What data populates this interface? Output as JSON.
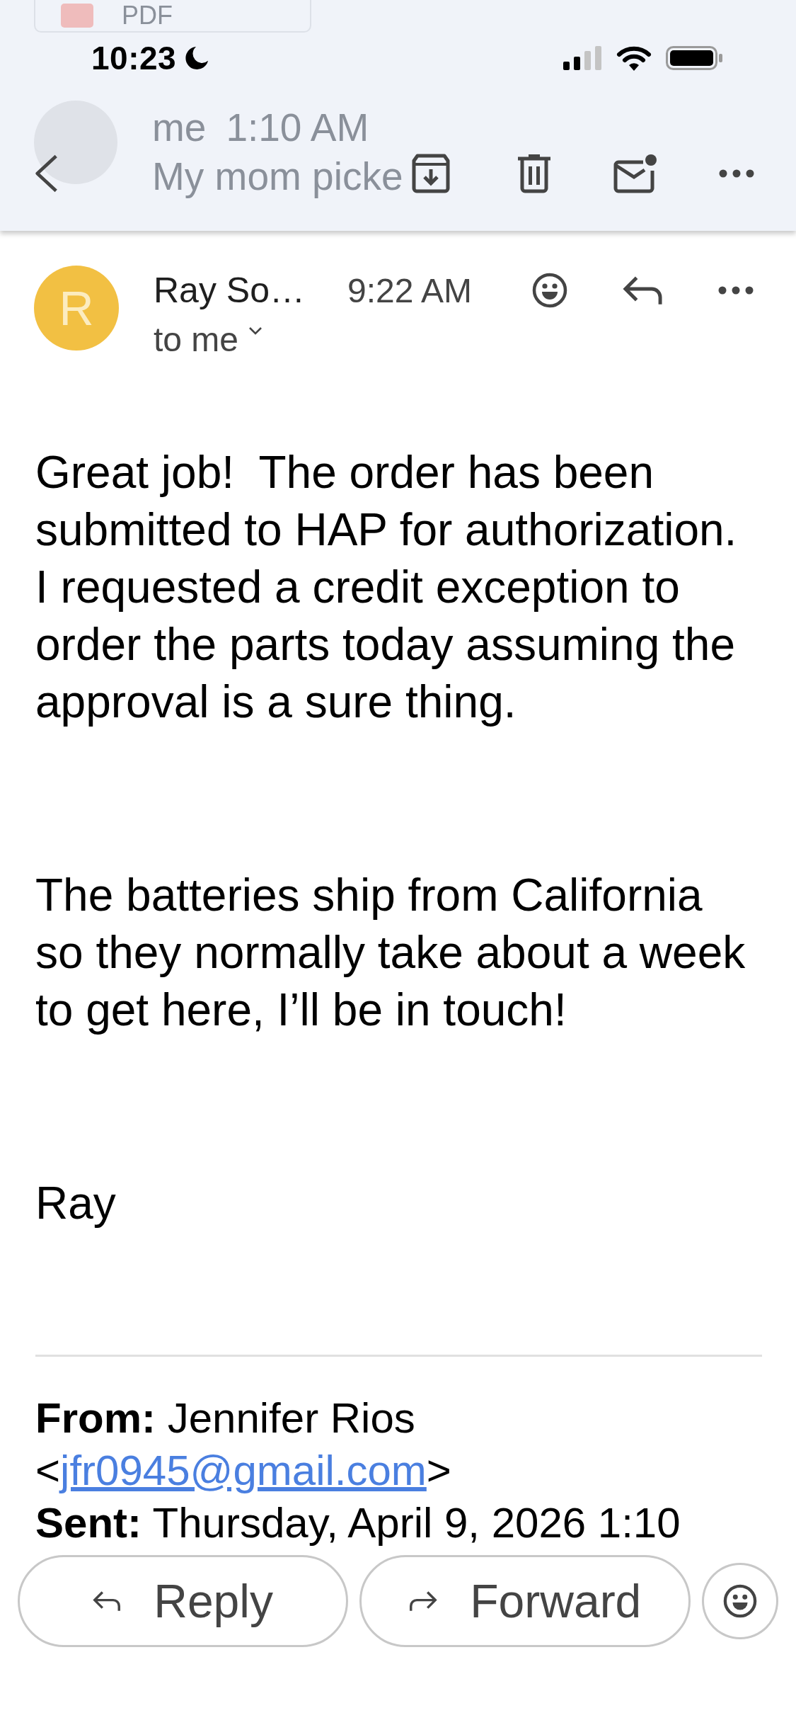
{
  "status_bar": {
    "time": "10:23",
    "focus_on": true
  },
  "behind_header": {
    "attachment": {
      "label": "PDF"
    },
    "previous_message": {
      "sender": "me",
      "time": "1:10 AM",
      "snippet": "My mom picke"
    }
  },
  "message": {
    "sender": {
      "initial": "R",
      "name": "Ray So…"
    },
    "time": "9:22 AM",
    "recipients": "to me",
    "details_expanded": false,
    "paragraphs": [
      "Great job!  The order has been submitted to HAP for authorization. I requested a credit exception to order the parts today assuming the approval is a sure thing.",
      "The batteries ship from California so they normally take about a week to get here, I’ll be in touch!",
      "Ray"
    ],
    "quoted_header": [
      {
        "label": "From:",
        "value": "Jennifer Rios",
        "link_before": "<",
        "link": "jfr0945@gmail.com",
        "link_after": ">"
      },
      {
        "label": "Sent:",
        "value": "Thursday, April 9, 2026 1:10"
      }
    ]
  },
  "bottom_actions": [
    {
      "kind": "reply",
      "label": "Reply"
    },
    {
      "kind": "forward",
      "label": "Forward"
    },
    {
      "kind": "react"
    }
  ]
}
